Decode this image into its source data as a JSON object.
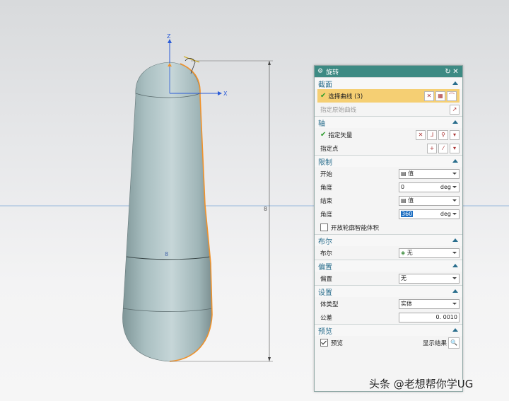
{
  "viewport": {
    "axis_labels": {
      "z": "Z",
      "x": "X"
    },
    "dim_height": "8",
    "dim_width": "8"
  },
  "dialog": {
    "title": "旋转",
    "sections": {
      "section_profile": {
        "header": "截面",
        "select_curve": "选择曲线 (3)",
        "specify_origin_curve": "指定原始曲线"
      },
      "axis": {
        "header": "轴",
        "specify_vector": "指定矢量",
        "specify_point": "指定点"
      },
      "limits": {
        "header": "限制",
        "start_label": "开始",
        "start_value": "值",
        "start_angle_label": "角度",
        "start_angle": "0",
        "end_label": "结束",
        "end_value": "值",
        "end_angle_label": "角度",
        "end_angle": "360",
        "unit": "deg",
        "open_profile": "开放轮廓智能体积"
      },
      "boolean": {
        "header": "布尔",
        "label": "布尔",
        "value": "无"
      },
      "offset": {
        "header": "偏置",
        "label": "偏置",
        "value": "无"
      },
      "settings": {
        "header": "设置",
        "body_type_label": "体类型",
        "body_type_value": "实体",
        "tolerance_label": "公差",
        "tolerance_value": "0. 0010"
      },
      "preview": {
        "header": "预览",
        "preview_label": "预览",
        "preview_checked": true,
        "show_result": "显示结果"
      }
    }
  },
  "watermark": "头条 @老想帮你学UG",
  "colors": {
    "accent": "#3d8a83",
    "highlight": "#f5cf73",
    "section_text": "#2a6e8d",
    "curve": "#f0922b"
  }
}
